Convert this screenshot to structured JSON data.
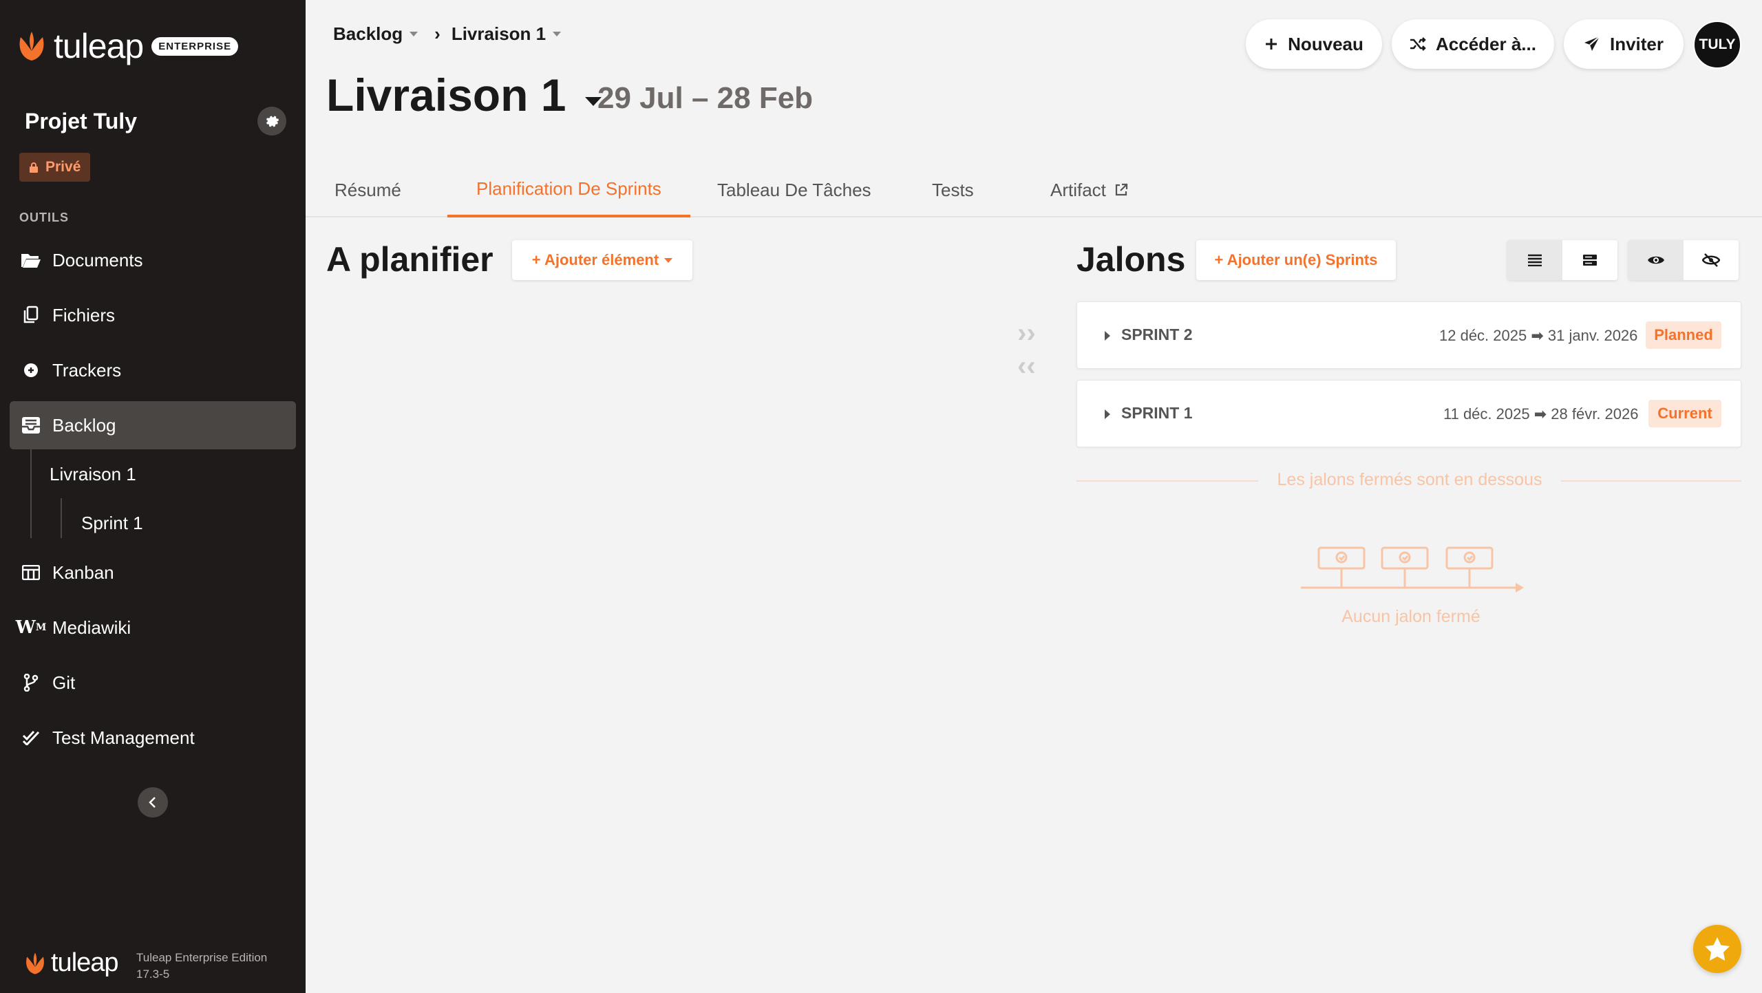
{
  "brand": {
    "logo_text": "tuleap",
    "edition_badge": "ENTERPRISE",
    "footer_logo_text": "tuleap",
    "footer_edition": "Tuleap Enterprise Edition",
    "footer_version": "17.3-5",
    "accent_color": "#f3722c"
  },
  "sidebar": {
    "project_name": "Projet Tuly",
    "privacy_label": "Privé",
    "tools_title": "OUTILS",
    "items": [
      {
        "label": "Documents",
        "icon": "folder-open-icon"
      },
      {
        "label": "Fichiers",
        "icon": "files-icon"
      },
      {
        "label": "Trackers",
        "icon": "trackers-icon"
      },
      {
        "label": "Backlog",
        "icon": "inbox-icon",
        "active": true
      },
      {
        "label": "Kanban",
        "icon": "kanban-icon"
      },
      {
        "label": "Mediawiki",
        "icon": "mediawiki-icon"
      },
      {
        "label": "Git",
        "icon": "git-branch-icon"
      },
      {
        "label": "Test Management",
        "icon": "check-double-icon"
      }
    ],
    "backlog_children": {
      "release": "Livraison 1",
      "sprint": "Sprint 1"
    }
  },
  "header": {
    "breadcrumb": [
      "Backlog",
      "Livraison 1"
    ],
    "title": "Livraison 1",
    "dates": "29 Jul – 28 Feb",
    "buttons": {
      "new": "Nouveau",
      "goto": "Accéder à...",
      "invite": "Inviter"
    },
    "avatar_initials": "TULY"
  },
  "tabs": [
    {
      "label": "Résumé"
    },
    {
      "label": "Planification De Sprints",
      "active": true
    },
    {
      "label": "Tableau De Tâches"
    },
    {
      "label": "Tests"
    },
    {
      "label": "Artifact"
    }
  ],
  "to_plan": {
    "title": "A planifier",
    "add_button": "+ Ajouter élément"
  },
  "milestones": {
    "title": "Jalons",
    "add_button": "+ Ajouter un(e) Sprints",
    "items": [
      {
        "name": "SPRINT 2",
        "start": "12 déc. 2025",
        "end": "31 janv. 2026",
        "status": "Planned"
      },
      {
        "name": "SPRINT 1",
        "start": "11 déc. 2025",
        "end": "28 févr. 2026",
        "status": "Current"
      }
    ],
    "closed_label": "Les jalons fermés sont en dessous",
    "empty_closed": "Aucun jalon fermé"
  }
}
